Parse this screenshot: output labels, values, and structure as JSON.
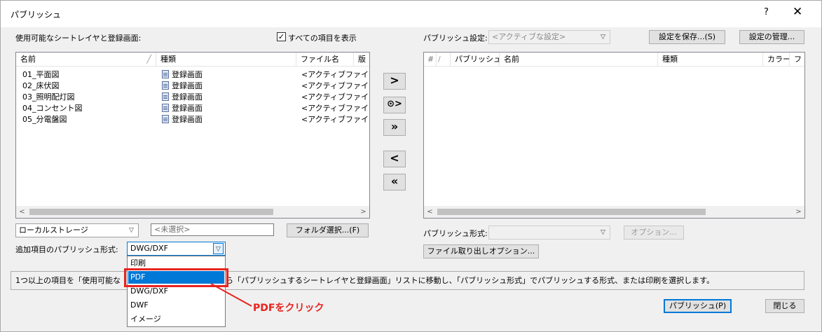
{
  "window": {
    "title": "パブリッシュ",
    "help": "?",
    "close": "✕"
  },
  "left": {
    "label": "使用可能なシートレイヤと登録画面:",
    "show_all_checked": true,
    "show_all_label": "すべての項目を表示",
    "columns": [
      "名前",
      "種類",
      "ファイル名",
      "版"
    ],
    "rows": [
      {
        "name": "01_平面図",
        "type": "登録画面",
        "file": "<アクティブファイ"
      },
      {
        "name": "02_床伏図",
        "type": "登録画面",
        "file": "<アクティブファイ"
      },
      {
        "name": "03_照明配灯図",
        "type": "登録画面",
        "file": "<アクティブファイ"
      },
      {
        "name": "04_コンセント図",
        "type": "登録画面",
        "file": "<アクティブファイ"
      },
      {
        "name": "05_分電盤図",
        "type": "登録画面",
        "file": "<アクティブファイ"
      }
    ],
    "storage_value": "ローカルストレージ",
    "folder_placeholder": "<未選択>",
    "folder_button": "フォルダ選択...(F)",
    "format_label": "追加項目のパブリッシュ形式:",
    "format_value": "DWG/DXF"
  },
  "transfer_buttons": [
    ">",
    "⊙>",
    "»",
    "<",
    "«"
  ],
  "right": {
    "settings_label": "パブリッシュ設定:",
    "settings_value": "<アクティブな設定>",
    "save_settings": "設定を保存...(S)",
    "manage_settings": "設定の管理...",
    "columns": [
      "#",
      "/",
      "パブリッシュ...",
      "名前",
      "種類",
      "カラー",
      "フ"
    ],
    "format_label": "パブリッシュ形式:",
    "format_value": "",
    "options_button": "オプション...",
    "export_options_button": "ファイル取り出しオプション..."
  },
  "dropdown": {
    "items": [
      "印刷",
      "PDF",
      "DWG/DXF",
      "DWF",
      "イメージ"
    ],
    "selected_index": 1
  },
  "status": "1つ以上の項目を「使用可能な",
  "status_tail": "ら「パブリッシュするシートレイヤと登録画面」リストに移動し、「パブリッシュ形式」でパブリッシュする形式、または印刷を選択します。",
  "footer": {
    "publish_button": "パブリッシュ(P)",
    "close_button": "閉じる"
  },
  "annotation": "PDFをクリック",
  "colors": {
    "accent": "#0078d7",
    "annotation": "#e8231f"
  }
}
